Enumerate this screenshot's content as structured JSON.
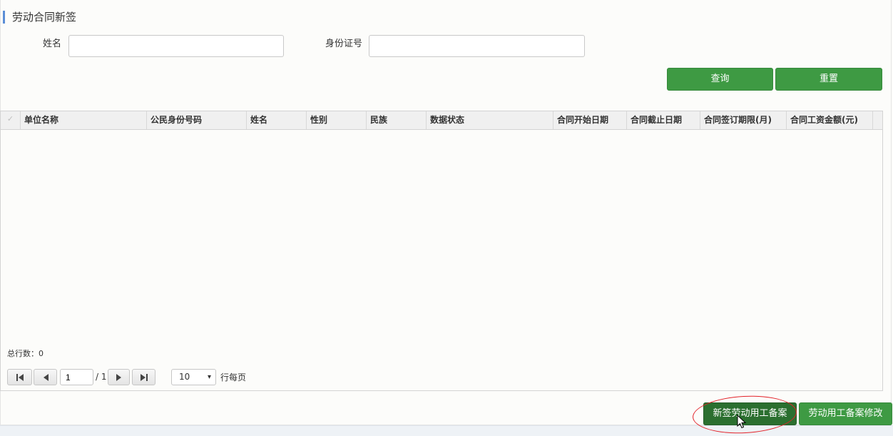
{
  "title": "劳动合同新签",
  "search": {
    "name_label": "姓名",
    "name_value": "",
    "id_label": "身份证号",
    "id_value": ""
  },
  "actions": {
    "query": "查询",
    "reset": "重置"
  },
  "grid": {
    "columns": [
      "单位名称",
      "公民身份号码",
      "姓名",
      "性别",
      "民族",
      "数据状态",
      "合同开始日期",
      "合同截止日期",
      "合同签订期限(月)",
      "合同工资金额(元)"
    ],
    "rows": [],
    "total_label": "总行数：",
    "total": "0"
  },
  "pager": {
    "current_page": "1",
    "total_pages": "/ 1",
    "page_size": "10",
    "per_page_label": "行每页",
    "first_icon": "first-page-icon",
    "prev_icon": "prev-page-icon",
    "next_icon": "next-page-icon",
    "last_icon": "last-page-icon"
  },
  "footer": {
    "new_filing": "新签劳动用工备案",
    "modify_filing": "劳动用工备案修改"
  },
  "colors": {
    "accent": "#5b8ed6",
    "button_green": "#3e9a43",
    "button_green_dark": "#2b6f2f",
    "highlight_red": "#e3232a"
  }
}
